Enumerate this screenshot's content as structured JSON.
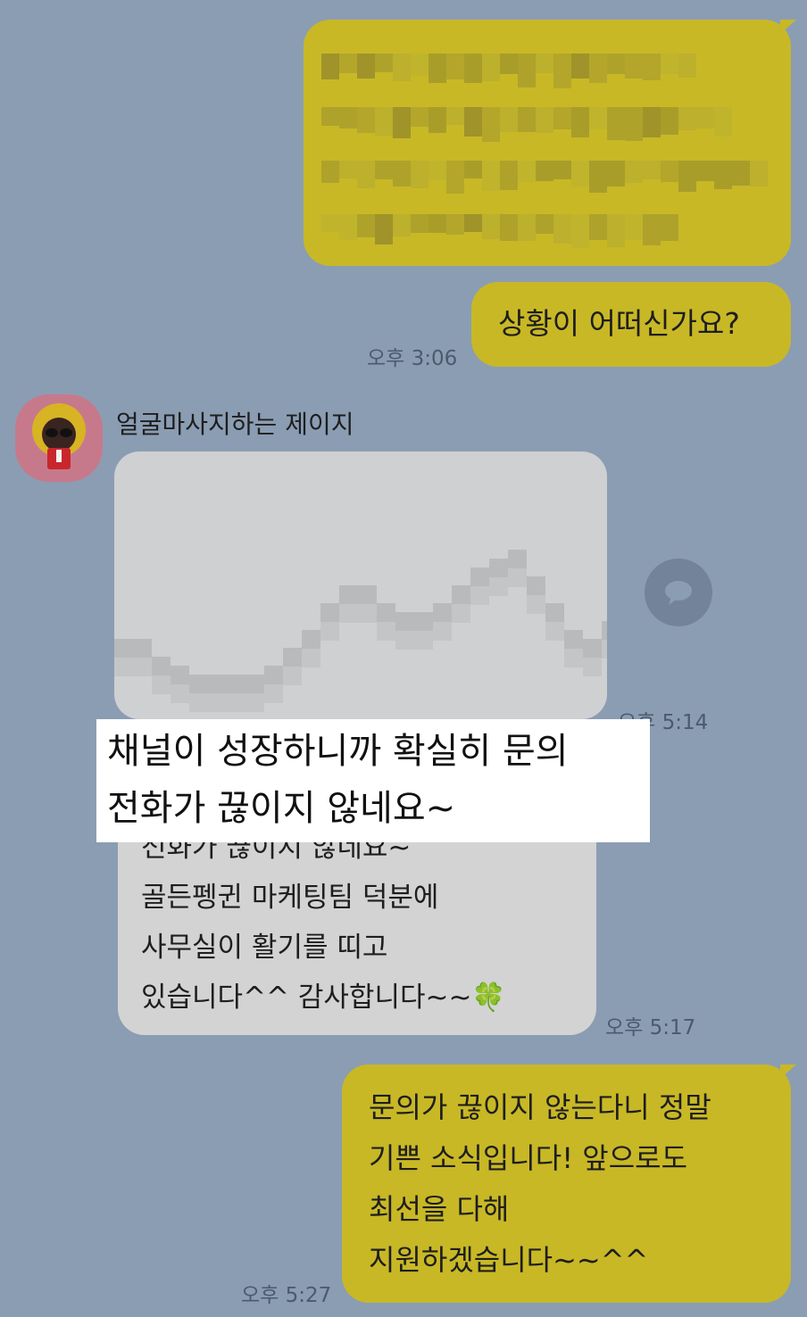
{
  "messages": {
    "m1_time": "",
    "m2_text": "상황이 어떠신가요?",
    "m2_time": "오후 3:06",
    "sender_name": "얼굴마사지하는 제이지",
    "image_time": "오후 5:14",
    "m3_text": "전화가 끊이지 않네요~\n골든펭귄 마케팅팀 덕분에\n사무실이 활기를 띠고\n있습니다^^ 감사합니다~~🍀",
    "m3_time": "오후 5:17",
    "m4_text": "문의가 끊이지 않는다니 정말\n기쁜 소식입니다! 앞으로도\n최선을 다해\n지원하겠습니다~~^^",
    "m4_time": "오후 5:27"
  },
  "caption": "채널이 성장하니까 확실히 문의\n전화가 끊이지 않네요~",
  "colors": {
    "background": "#8b9db3",
    "my_bubble": "#c8b826",
    "other_bubble": "#d3d3d3"
  },
  "icons": {
    "share": "speech-bubble-icon"
  }
}
